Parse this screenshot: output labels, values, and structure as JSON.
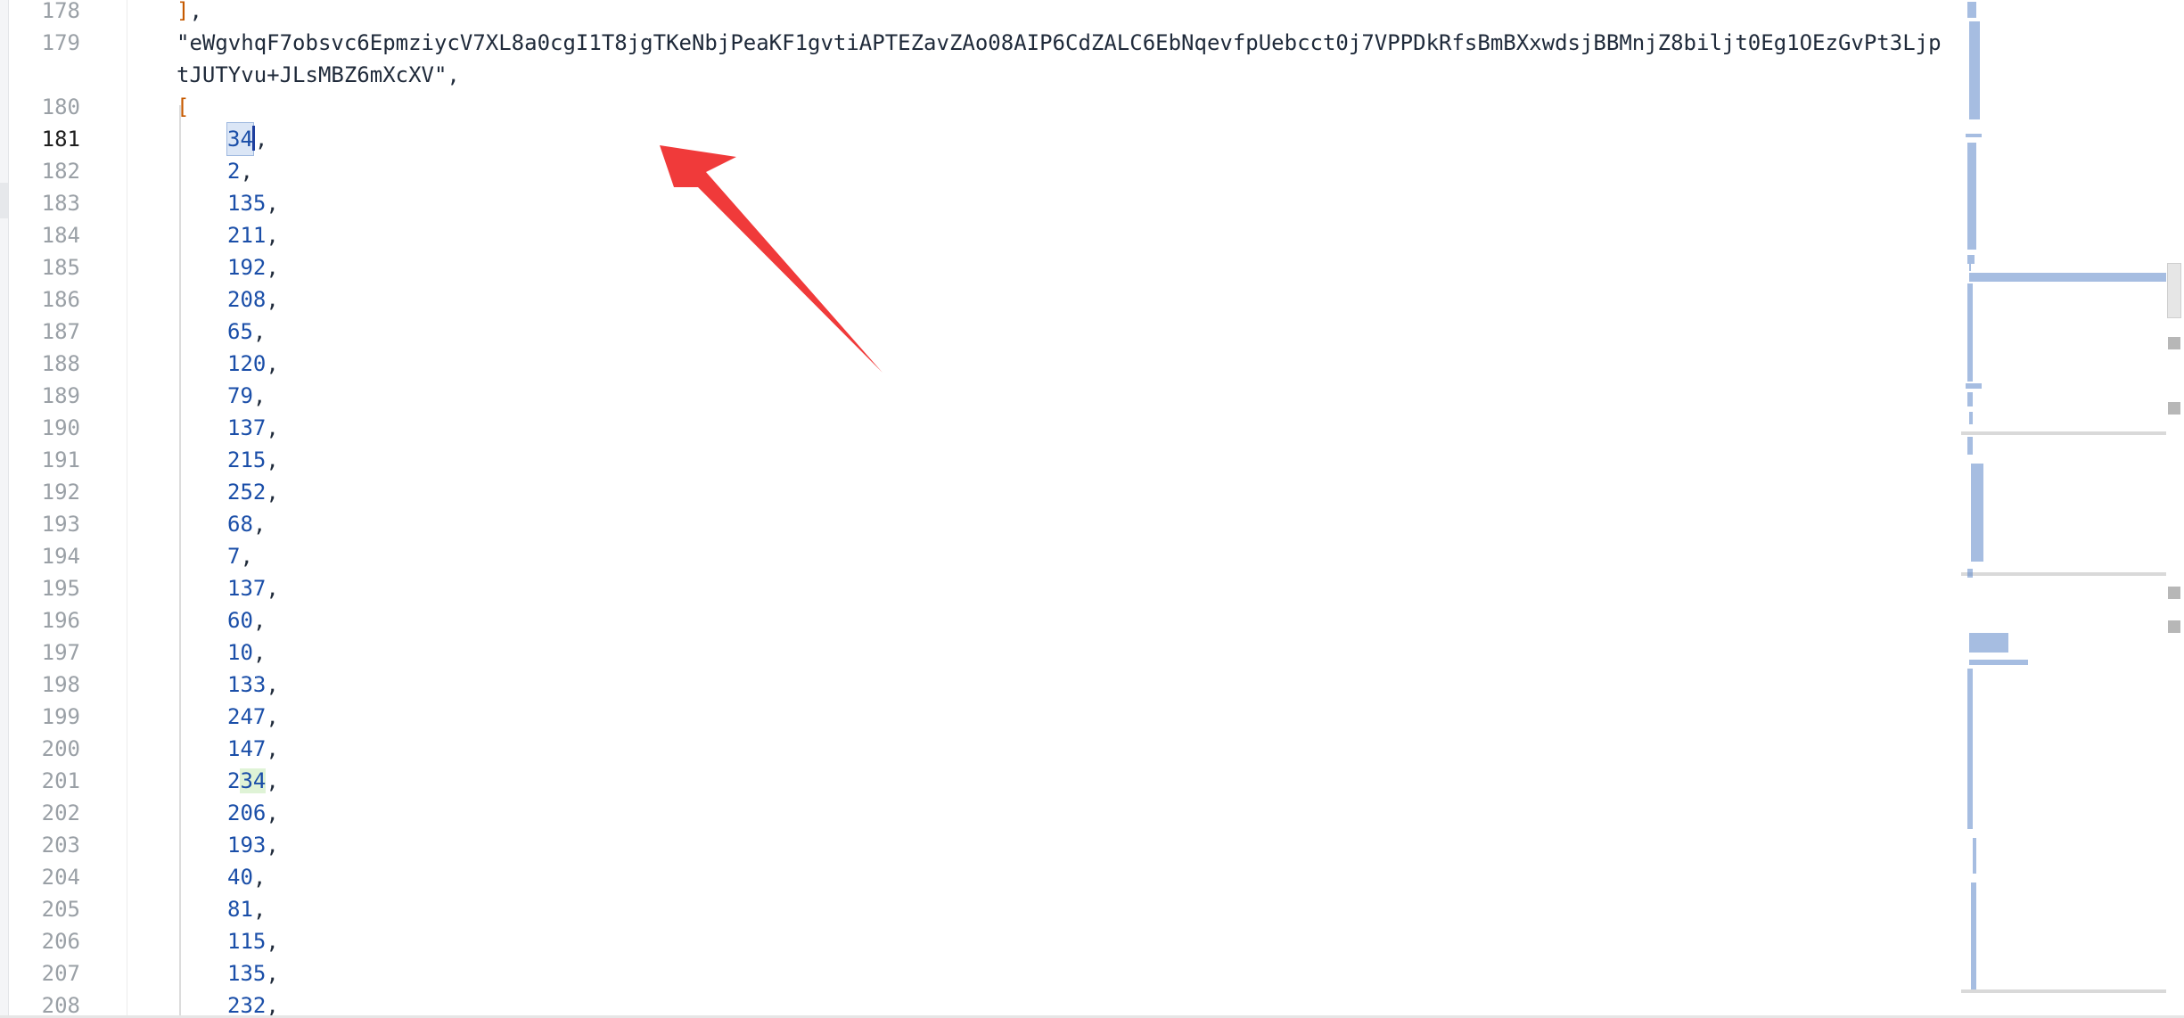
{
  "editor": {
    "lines": [
      {
        "num": "178",
        "text": "],",
        "kind": "bracket-close"
      },
      {
        "num": "179",
        "text": "\"eWgvhqF7obsvc6EpmziycV7XL8a0cgI1T8jgTKeNbjPeaKF1gvtiAPTEZavZAo08AIP6CdZALC6EbNqevfpUebcct0j7VPPDkRfsBmBXxwdsjBBMnjZ8biljt0Eg1OEzGvPt3Ljp",
        "kind": "string"
      },
      {
        "num": "",
        "text": "tJUTYvu+JLsMBZ6mXcXV\",",
        "kind": "string-wrap"
      },
      {
        "num": "180",
        "text": "[",
        "kind": "bracket-open"
      },
      {
        "num": "181",
        "value": "34",
        "active": true,
        "kind": "number-selected"
      },
      {
        "num": "182",
        "value": "2",
        "kind": "number"
      },
      {
        "num": "183",
        "value": "135",
        "kind": "number"
      },
      {
        "num": "184",
        "value": "211",
        "kind": "number"
      },
      {
        "num": "185",
        "value": "192",
        "kind": "number"
      },
      {
        "num": "186",
        "value": "208",
        "kind": "number"
      },
      {
        "num": "187",
        "value": "65",
        "kind": "number"
      },
      {
        "num": "188",
        "value": "120",
        "kind": "number"
      },
      {
        "num": "189",
        "value": "79",
        "kind": "number"
      },
      {
        "num": "190",
        "value": "137",
        "kind": "number"
      },
      {
        "num": "191",
        "value": "215",
        "kind": "number"
      },
      {
        "num": "192",
        "value": "252",
        "kind": "number"
      },
      {
        "num": "193",
        "value": "68",
        "kind": "number"
      },
      {
        "num": "194",
        "value": "7",
        "kind": "number"
      },
      {
        "num": "195",
        "value": "137",
        "kind": "number"
      },
      {
        "num": "196",
        "value": "60",
        "kind": "number"
      },
      {
        "num": "197",
        "value": "10",
        "kind": "number"
      },
      {
        "num": "198",
        "value": "133",
        "kind": "number"
      },
      {
        "num": "199",
        "value": "247",
        "kind": "number"
      },
      {
        "num": "200",
        "value": "147",
        "kind": "number"
      },
      {
        "num": "201",
        "value": "234",
        "kind": "number-highlight"
      },
      {
        "num": "202",
        "value": "206",
        "kind": "number"
      },
      {
        "num": "203",
        "value": "193",
        "kind": "number"
      },
      {
        "num": "204",
        "value": "40",
        "kind": "number"
      },
      {
        "num": "205",
        "value": "81",
        "kind": "number"
      },
      {
        "num": "206",
        "value": "115",
        "kind": "number"
      },
      {
        "num": "207",
        "value": "135",
        "kind": "number"
      },
      {
        "num": "208",
        "value": "232",
        "kind": "number"
      }
    ],
    "punctuation": {
      "comma": ","
    }
  },
  "colors": {
    "number": "#1a4ea8",
    "bracket": "#c65a00",
    "text": "#1f2a3a",
    "annotation_arrow": "#f03a3a"
  },
  "annotation": {
    "icon": "red-arrow-icon"
  },
  "minimap": {
    "label": "code-minimap"
  }
}
